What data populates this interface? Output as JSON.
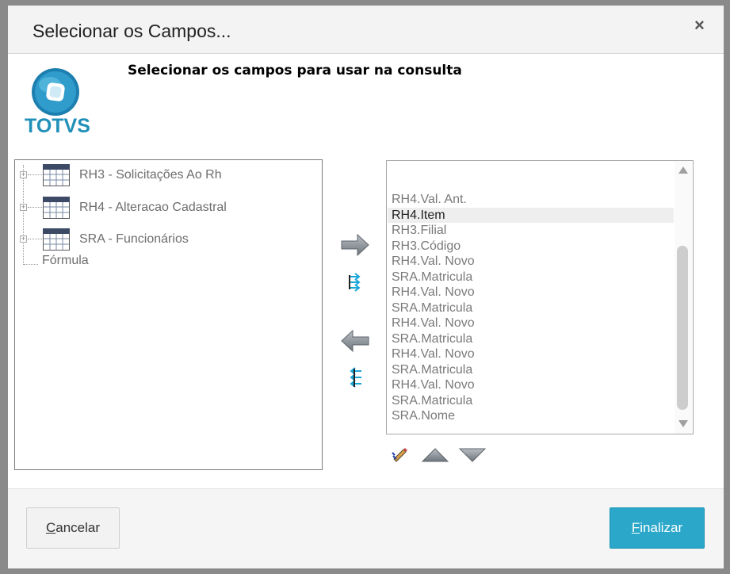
{
  "dialog": {
    "title": "Selecionar os Campos...",
    "close_label": "×",
    "subtitle": "Selecionar os campos para usar na consulta"
  },
  "logo": {
    "text": "TOTVS",
    "color": "#2090b8"
  },
  "tree": {
    "items": [
      {
        "label": "RH3 - Solicitações Ao Rh",
        "icon": "table-icon"
      },
      {
        "label": "RH4 - Alteracao Cadastral",
        "icon": "table-icon"
      },
      {
        "label": "SRA - Funcionários",
        "icon": "table-icon"
      }
    ],
    "formula_label": "Fórmula"
  },
  "transfer_buttons": [
    {
      "name": "add-selected-arrow",
      "icon": "arrow-right-icon"
    },
    {
      "name": "add-all-arrow",
      "icon": "double-arrow-right-icon"
    },
    {
      "name": "remove-selected-arrow",
      "icon": "arrow-left-icon"
    },
    {
      "name": "remove-all-arrow",
      "icon": "double-arrow-left-icon"
    }
  ],
  "selected_fields": {
    "items": [
      "RH4.Val. Ant.",
      "RH4.Item",
      "RH3.Filial",
      "RH3.Código",
      "RH4.Val. Novo",
      "SRA.Matricula",
      "RH4.Val. Novo",
      "SRA.Matricula",
      "RH4.Val. Novo",
      "SRA.Matricula",
      "RH4.Val. Novo",
      "SRA.Matricula",
      "RH4.Val. Novo",
      "SRA.Matricula",
      "SRA.Nome"
    ],
    "selected_index": 1
  },
  "order_buttons": [
    {
      "name": "edit-field-button",
      "icon": "pencil-icon"
    },
    {
      "name": "move-up-button",
      "icon": "triangle-up-icon"
    },
    {
      "name": "move-down-button",
      "icon": "triangle-down-icon"
    }
  ],
  "footer": {
    "cancel_first": "C",
    "cancel_rest": "ancelar",
    "finish_first": "F",
    "finish_rest": "inalizar"
  },
  "colors": {
    "accent": "#2aa7c9",
    "selected_row": "#eeeeee"
  }
}
